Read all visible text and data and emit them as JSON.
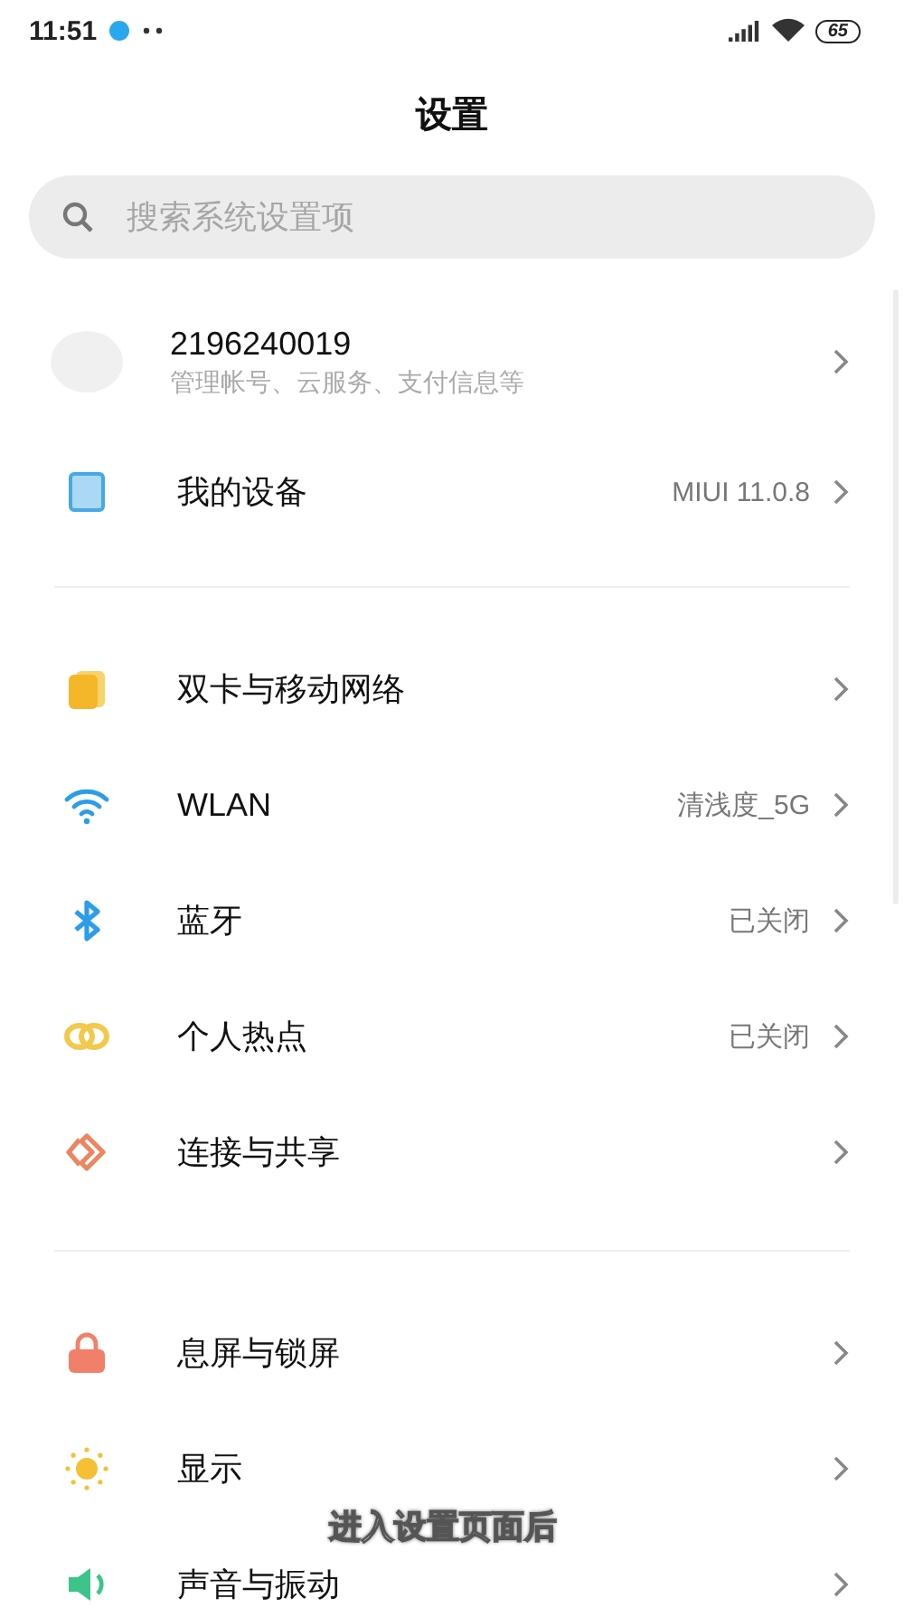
{
  "status_bar": {
    "time": "11:51",
    "battery": "65"
  },
  "title": "设置",
  "search": {
    "placeholder": "搜索系统设置项"
  },
  "account": {
    "name": "2196240019",
    "subtitle": "管理帐号、云服务、支付信息等"
  },
  "groups": [
    {
      "items": [
        {
          "kind": "device",
          "label": "我的设备",
          "value": "MIUI 11.0.8"
        }
      ]
    },
    {
      "items": [
        {
          "kind": "sim",
          "label": "双卡与移动网络"
        },
        {
          "kind": "wifi",
          "label": "WLAN",
          "value": "清浅度_5G"
        },
        {
          "kind": "bluetooth",
          "label": "蓝牙",
          "value": "已关闭"
        },
        {
          "kind": "hotspot",
          "label": "个人热点",
          "value": "已关闭"
        },
        {
          "kind": "share",
          "label": "连接与共享"
        }
      ]
    },
    {
      "items": [
        {
          "kind": "lock",
          "label": "息屏与锁屏"
        },
        {
          "kind": "sun",
          "label": "显示"
        },
        {
          "kind": "speaker",
          "label": "声音与振动"
        }
      ]
    }
  ],
  "caption": "进入设置页面后"
}
